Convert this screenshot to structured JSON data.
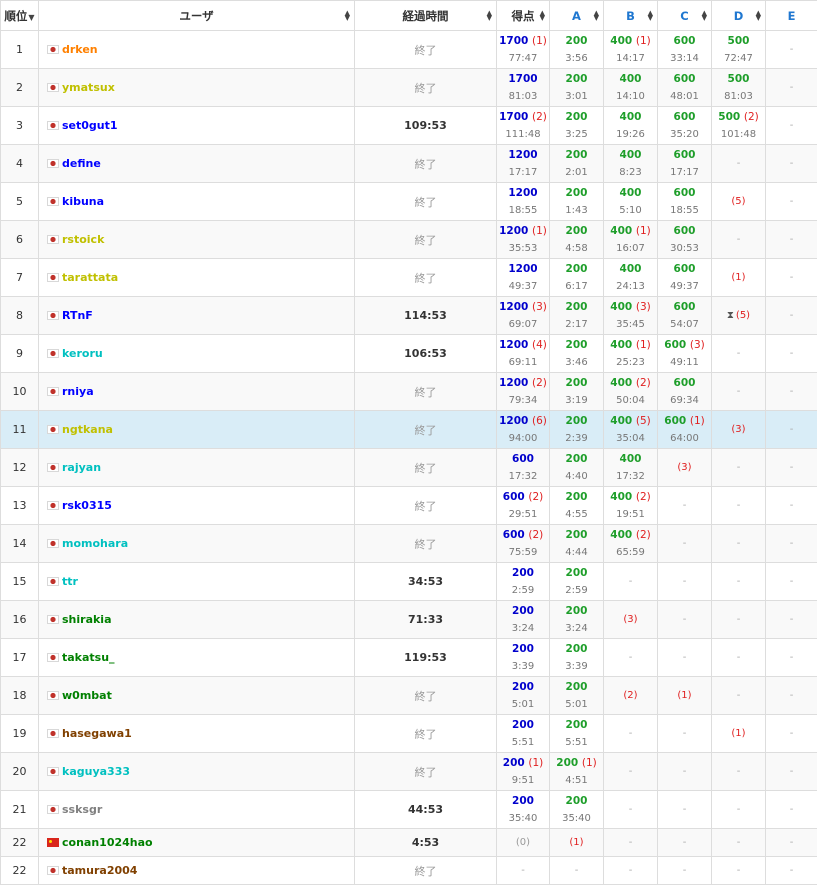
{
  "header": {
    "rank": "順位",
    "user": "ユーザ",
    "elapsed": "経過時間",
    "score": "得点",
    "problems": [
      "A",
      "B",
      "C",
      "D",
      "E"
    ]
  },
  "colors": {
    "orange": "#ff8000",
    "yellow": "#c0c000",
    "blue": "#0000ff",
    "cyan": "#00c0c0",
    "green": "#008000",
    "brown": "#804000",
    "gray": "#808080",
    "total_score": "#0000cc",
    "accepted": "#1e9e2a",
    "penalty": "#e02020",
    "highlight_row": "#d9edf7"
  },
  "rows": [
    {
      "rank": "1",
      "flag": "jp",
      "user": "drken",
      "color": "orange",
      "elapsed": "終了",
      "finished": true,
      "total": {
        "score": "1700",
        "pen": "(1)",
        "time": "77:47"
      },
      "problems": [
        {
          "score": "200",
          "time": "3:56"
        },
        {
          "score": "400",
          "pen": "(1)",
          "time": "14:17"
        },
        {
          "score": "600",
          "time": "33:14"
        },
        {
          "score": "500",
          "time": "72:47"
        },
        {
          "dash": "-"
        }
      ]
    },
    {
      "rank": "2",
      "flag": "jp",
      "user": "ymatsux",
      "color": "yellow",
      "elapsed": "終了",
      "finished": true,
      "total": {
        "score": "1700",
        "time": "81:03"
      },
      "problems": [
        {
          "score": "200",
          "time": "3:01"
        },
        {
          "score": "400",
          "time": "14:10"
        },
        {
          "score": "600",
          "time": "48:01"
        },
        {
          "score": "500",
          "time": "81:03"
        },
        {
          "dash": "-"
        }
      ]
    },
    {
      "rank": "3",
      "flag": "jp",
      "user": "set0gut1",
      "color": "blue",
      "elapsed": "109:53",
      "finished": false,
      "total": {
        "score": "1700",
        "pen": "(2)",
        "time": "111:48"
      },
      "problems": [
        {
          "score": "200",
          "time": "3:25"
        },
        {
          "score": "400",
          "time": "19:26"
        },
        {
          "score": "600",
          "time": "35:20"
        },
        {
          "score": "500",
          "pen": "(2)",
          "time": "101:48"
        },
        {
          "dash": "-"
        }
      ]
    },
    {
      "rank": "4",
      "flag": "jp",
      "user": "define",
      "color": "blue",
      "elapsed": "終了",
      "finished": true,
      "total": {
        "score": "1200",
        "time": "17:17"
      },
      "problems": [
        {
          "score": "200",
          "time": "2:01"
        },
        {
          "score": "400",
          "time": "8:23"
        },
        {
          "score": "600",
          "time": "17:17"
        },
        {
          "dash": "-"
        },
        {
          "dash": "-"
        }
      ]
    },
    {
      "rank": "5",
      "flag": "jp",
      "user": "kibuna",
      "color": "blue",
      "elapsed": "終了",
      "finished": true,
      "total": {
        "score": "1200",
        "time": "18:55"
      },
      "problems": [
        {
          "score": "200",
          "time": "1:43"
        },
        {
          "score": "400",
          "time": "5:10"
        },
        {
          "score": "600",
          "time": "18:55"
        },
        {
          "wa": "(5)"
        },
        {
          "dash": "-"
        }
      ]
    },
    {
      "rank": "6",
      "flag": "jp",
      "user": "rstoick",
      "color": "yellow",
      "elapsed": "終了",
      "finished": true,
      "total": {
        "score": "1200",
        "pen": "(1)",
        "time": "35:53"
      },
      "problems": [
        {
          "score": "200",
          "time": "4:58"
        },
        {
          "score": "400",
          "pen": "(1)",
          "time": "16:07"
        },
        {
          "score": "600",
          "time": "30:53"
        },
        {
          "dash": "-"
        },
        {
          "dash": "-"
        }
      ]
    },
    {
      "rank": "7",
      "flag": "jp",
      "user": "tarattata",
      "color": "yellow",
      "elapsed": "終了",
      "finished": true,
      "total": {
        "score": "1200",
        "time": "49:37"
      },
      "problems": [
        {
          "score": "200",
          "time": "6:17"
        },
        {
          "score": "400",
          "time": "24:13"
        },
        {
          "score": "600",
          "time": "49:37"
        },
        {
          "wa": "(1)"
        },
        {
          "dash": "-"
        }
      ]
    },
    {
      "rank": "8",
      "flag": "jp",
      "user": "RTnF",
      "color": "blue",
      "elapsed": "114:53",
      "finished": false,
      "total": {
        "score": "1200",
        "pen": "(3)",
        "time": "69:07"
      },
      "problems": [
        {
          "score": "200",
          "time": "2:17"
        },
        {
          "score": "400",
          "pen": "(3)",
          "time": "35:45"
        },
        {
          "score": "600",
          "time": "54:07"
        },
        {
          "wa": "(5)",
          "pending": true
        },
        {
          "dash": "-"
        }
      ]
    },
    {
      "rank": "9",
      "flag": "jp",
      "user": "keroru",
      "color": "cyan",
      "elapsed": "106:53",
      "finished": false,
      "total": {
        "score": "1200",
        "pen": "(4)",
        "time": "69:11"
      },
      "problems": [
        {
          "score": "200",
          "time": "3:46"
        },
        {
          "score": "400",
          "pen": "(1)",
          "time": "25:23"
        },
        {
          "score": "600",
          "pen": "(3)",
          "time": "49:11"
        },
        {
          "dash": "-"
        },
        {
          "dash": "-"
        }
      ]
    },
    {
      "rank": "10",
      "flag": "jp",
      "user": "rniya",
      "color": "blue",
      "elapsed": "終了",
      "finished": true,
      "total": {
        "score": "1200",
        "pen": "(2)",
        "time": "79:34"
      },
      "problems": [
        {
          "score": "200",
          "time": "3:19"
        },
        {
          "score": "400",
          "pen": "(2)",
          "time": "50:04"
        },
        {
          "score": "600",
          "time": "69:34"
        },
        {
          "dash": "-"
        },
        {
          "dash": "-"
        }
      ]
    },
    {
      "rank": "11",
      "flag": "jp",
      "user": "ngtkana",
      "color": "yellow",
      "elapsed": "終了",
      "finished": true,
      "highlight": true,
      "total": {
        "score": "1200",
        "pen": "(6)",
        "time": "94:00"
      },
      "problems": [
        {
          "score": "200",
          "time": "2:39"
        },
        {
          "score": "400",
          "pen": "(5)",
          "time": "35:04"
        },
        {
          "score": "600",
          "pen": "(1)",
          "time": "64:00"
        },
        {
          "wa": "(3)"
        },
        {
          "dash": "-"
        }
      ]
    },
    {
      "rank": "12",
      "flag": "jp",
      "user": "rajyan",
      "color": "cyan",
      "elapsed": "終了",
      "finished": true,
      "total": {
        "score": "600",
        "time": "17:32"
      },
      "problems": [
        {
          "score": "200",
          "time": "4:40"
        },
        {
          "score": "400",
          "time": "17:32"
        },
        {
          "wa": "(3)"
        },
        {
          "dash": "-"
        },
        {
          "dash": "-"
        }
      ]
    },
    {
      "rank": "13",
      "flag": "jp",
      "user": "rsk0315",
      "color": "blue",
      "elapsed": "終了",
      "finished": true,
      "total": {
        "score": "600",
        "pen": "(2)",
        "time": "29:51"
      },
      "problems": [
        {
          "score": "200",
          "time": "4:55"
        },
        {
          "score": "400",
          "pen": "(2)",
          "time": "19:51"
        },
        {
          "dash": "-"
        },
        {
          "dash": "-"
        },
        {
          "dash": "-"
        }
      ]
    },
    {
      "rank": "14",
      "flag": "jp",
      "user": "momohara",
      "color": "cyan",
      "elapsed": "終了",
      "finished": true,
      "total": {
        "score": "600",
        "pen": "(2)",
        "time": "75:59"
      },
      "problems": [
        {
          "score": "200",
          "time": "4:44"
        },
        {
          "score": "400",
          "pen": "(2)",
          "time": "65:59"
        },
        {
          "dash": "-"
        },
        {
          "dash": "-"
        },
        {
          "dash": "-"
        }
      ]
    },
    {
      "rank": "15",
      "flag": "jp",
      "user": "ttr",
      "color": "cyan",
      "elapsed": "34:53",
      "finished": false,
      "total": {
        "score": "200",
        "time": "2:59"
      },
      "problems": [
        {
          "score": "200",
          "time": "2:59"
        },
        {
          "dash": "-"
        },
        {
          "dash": "-"
        },
        {
          "dash": "-"
        },
        {
          "dash": "-"
        }
      ]
    },
    {
      "rank": "16",
      "flag": "jp",
      "user": "shirakia",
      "color": "green",
      "elapsed": "71:33",
      "finished": false,
      "total": {
        "score": "200",
        "time": "3:24"
      },
      "problems": [
        {
          "score": "200",
          "time": "3:24"
        },
        {
          "wa": "(3)"
        },
        {
          "dash": "-"
        },
        {
          "dash": "-"
        },
        {
          "dash": "-"
        }
      ]
    },
    {
      "rank": "17",
      "flag": "jp",
      "user": "takatsu_",
      "color": "green",
      "elapsed": "119:53",
      "finished": false,
      "total": {
        "score": "200",
        "time": "3:39"
      },
      "problems": [
        {
          "score": "200",
          "time": "3:39"
        },
        {
          "dash": "-"
        },
        {
          "dash": "-"
        },
        {
          "dash": "-"
        },
        {
          "dash": "-"
        }
      ]
    },
    {
      "rank": "18",
      "flag": "jp",
      "user": "w0mbat",
      "color": "green",
      "elapsed": "終了",
      "finished": true,
      "total": {
        "score": "200",
        "time": "5:01"
      },
      "problems": [
        {
          "score": "200",
          "time": "5:01"
        },
        {
          "wa": "(2)"
        },
        {
          "wa": "(1)"
        },
        {
          "dash": "-"
        },
        {
          "dash": "-"
        }
      ]
    },
    {
      "rank": "19",
      "flag": "jp",
      "user": "hasegawa1",
      "color": "brown",
      "elapsed": "終了",
      "finished": true,
      "total": {
        "score": "200",
        "time": "5:51"
      },
      "problems": [
        {
          "score": "200",
          "time": "5:51"
        },
        {
          "dash": "-"
        },
        {
          "dash": "-"
        },
        {
          "wa": "(1)"
        },
        {
          "dash": "-"
        }
      ]
    },
    {
      "rank": "20",
      "flag": "jp",
      "user": "kaguya333",
      "color": "cyan",
      "elapsed": "終了",
      "finished": true,
      "total": {
        "score": "200",
        "pen": "(1)",
        "time": "9:51"
      },
      "problems": [
        {
          "score": "200",
          "pen": "(1)",
          "time": "4:51"
        },
        {
          "dash": "-"
        },
        {
          "dash": "-"
        },
        {
          "dash": "-"
        },
        {
          "dash": "-"
        }
      ]
    },
    {
      "rank": "21",
      "flag": "jp",
      "user": "ssksgr",
      "color": "gray",
      "elapsed": "44:53",
      "finished": false,
      "total": {
        "score": "200",
        "time": "35:40"
      },
      "problems": [
        {
          "score": "200",
          "time": "35:40"
        },
        {
          "dash": "-"
        },
        {
          "dash": "-"
        },
        {
          "dash": "-"
        },
        {
          "dash": "-"
        }
      ]
    },
    {
      "rank": "22",
      "flag": "cn",
      "user": "conan1024hao",
      "color": "green",
      "elapsed": "4:53",
      "finished": false,
      "short": true,
      "total": {
        "zero": "(0)"
      },
      "problems": [
        {
          "wa": "(1)"
        },
        {
          "dash": "-"
        },
        {
          "dash": "-"
        },
        {
          "dash": "-"
        },
        {
          "dash": "-"
        }
      ]
    },
    {
      "rank": "22",
      "flag": "jp",
      "user": "tamura2004",
      "color": "brown",
      "elapsed": "終了",
      "finished": true,
      "short": true,
      "total": {
        "dash": "-"
      },
      "problems": [
        {
          "dash": "-"
        },
        {
          "dash": "-"
        },
        {
          "dash": "-"
        },
        {
          "dash": "-"
        },
        {
          "dash": "-"
        }
      ]
    }
  ]
}
